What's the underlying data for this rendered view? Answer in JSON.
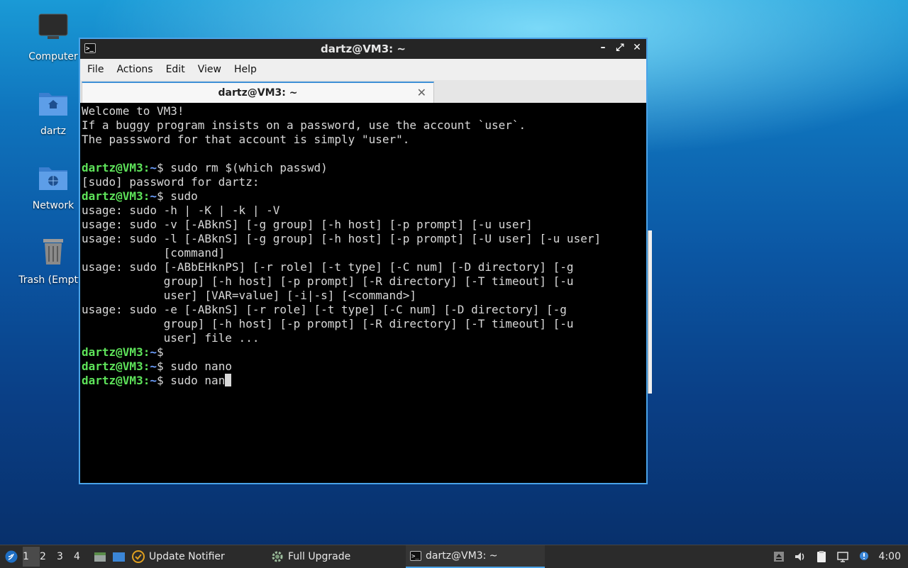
{
  "desktop": {
    "icons": [
      {
        "label": "Computer"
      },
      {
        "label": "dartz"
      },
      {
        "label": "Network"
      },
      {
        "label": "Trash (Empty)"
      }
    ]
  },
  "window": {
    "title": "dartz@VM3: ~",
    "menu": [
      "File",
      "Actions",
      "Edit",
      "View",
      "Help"
    ],
    "tab_label": "dartz@VM3: ~",
    "prompt_user": "dartz@VM3",
    "prompt_sep": ":",
    "prompt_dir": "~",
    "prompt_sign": "$",
    "lines": {
      "l1": "Welcome to VM3!",
      "l2": "If a buggy program insists on a password, use the account `user`.",
      "l3": "The passsword for that account is simply \"user\".",
      "cmd1": " sudo rm $(which passwd)",
      "l5": "[sudo] password for dartz:",
      "cmd2": " sudo",
      "u1": "usage: sudo -h | -K | -k | -V",
      "u2": "usage: sudo -v [-ABknS] [-g group] [-h host] [-p prompt] [-u user]",
      "u3": "usage: sudo -l [-ABknS] [-g group] [-h host] [-p prompt] [-U user] [-u user]",
      "u3b": "            [command]",
      "u4": "usage: sudo [-ABbEHknPS] [-r role] [-t type] [-C num] [-D directory] [-g",
      "u4b": "            group] [-h host] [-p prompt] [-R directory] [-T timeout] [-u",
      "u4c": "            user] [VAR=value] [-i|-s] [<command>]",
      "u5": "usage: sudo -e [-ABknS] [-r role] [-t type] [-C num] [-D directory] [-g",
      "u5b": "            group] [-h host] [-p prompt] [-R directory] [-T timeout] [-u",
      "u5c": "            user] file ...",
      "cmd3": "",
      "cmd4": " sudo nano",
      "cmd5": " sudo nan"
    }
  },
  "taskbar": {
    "workspaces": [
      "1",
      "2",
      "3",
      "4"
    ],
    "tasks": [
      {
        "label": "Update Notifier"
      },
      {
        "label": "Full Upgrade"
      },
      {
        "label": "dartz@VM3: ~"
      }
    ],
    "clock": "4:00"
  }
}
